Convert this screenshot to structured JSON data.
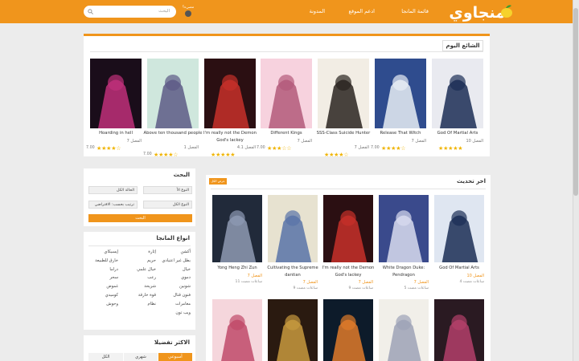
{
  "header": {
    "logo_text": "منجاوي",
    "nav": [
      "قائمة المانجا",
      "ادعم الموقع",
      "المدونة"
    ],
    "search_placeholder": "البحث",
    "mode_label": "مضيء؟",
    "brand_color": "#f0951c"
  },
  "trending": {
    "title": "الشائع اليوم",
    "items": [
      {
        "title": "God Of Martial Arts",
        "chapter": "الفصل 10",
        "rating": "",
        "stars": 5,
        "cover": [
          "#e9eaf0",
          "#1b2d55"
        ]
      },
      {
        "title": "Release That Witch",
        "chapter": "الفصل 7",
        "rating": "7.00",
        "stars": 4,
        "cover": [
          "#2f4c8e",
          "#e8eef5"
        ]
      },
      {
        "title": "SSS-Class Suicide Hunter",
        "chapter": "الفصل 7",
        "rating": "",
        "stars": 4,
        "cover": [
          "#f2ede4",
          "#2a2320"
        ]
      },
      {
        "title": "Different Kings",
        "chapter": "الفصل 7",
        "rating": "7.00",
        "stars": 3,
        "cover": [
          "#f7d2de",
          "#b35a7a"
        ]
      },
      {
        "title": "I'm really not the Demon God's lackey",
        "chapter": "الفصل 4.1",
        "rating": "",
        "stars": 5,
        "cover": [
          "#2b0f12",
          "#c7302a"
        ]
      },
      {
        "title": "Above ten thousand people",
        "chapter": "الفصل 1",
        "rating": "7.00",
        "stars": 4,
        "cover": [
          "#cfe7dd",
          "#5d5a86"
        ]
      },
      {
        "title": "Hoarding in hell",
        "chapter": "الفصل 7",
        "rating": "7.00",
        "stars": 4,
        "cover": [
          "#1a0d1a",
          "#c0307a"
        ]
      }
    ]
  },
  "search_panel": {
    "title": "البحث",
    "selects": [
      "النوع الأ",
      "الحالة الكل",
      "النوع الكل",
      "ترتيب بحسب: الافتراضي"
    ],
    "button": "البحث"
  },
  "genres": {
    "title": "انواع المانجا",
    "col_right": [
      "أكشن",
      "بطل غير اعتيادي",
      "خيال",
      "دموي",
      "شونين",
      "فنون قتال",
      "مغامرات",
      "ويب تون"
    ],
    "col_mid": [
      "إثارة",
      "حريم",
      "خيال علمي",
      "رعب",
      "شريحة",
      "قوة خارقة",
      "نظام"
    ],
    "col_left": [
      "إيسيكاي",
      "خارق للطبيعة",
      "دراما",
      "سحر",
      "غموض",
      "كوميدي",
      "وحوش"
    ]
  },
  "most_viewed": {
    "title": "الاكثر تفضيلا",
    "tabs": [
      "أسبوعي",
      "شهري",
      "الكل"
    ]
  },
  "latest": {
    "title": "اخر تحديث",
    "badge": "عرض الكل",
    "items": [
      {
        "title": "God Of Martial Arts",
        "chapter": "الفصل 10",
        "time": "4 ساعات مضت",
        "cover": [
          "#dfe6f1",
          "#1b2d55"
        ]
      },
      {
        "title": "White Dragon Duke: Pendragon",
        "chapter": "الفصل 7",
        "time": "5 ساعات مضت",
        "cover": [
          "#3a4a8c",
          "#d9dcef"
        ]
      },
      {
        "title": "I'm really not the Demon God's lackey",
        "chapter": "الفصل 7",
        "time": "9 ساعات مضت",
        "cover": [
          "#2b0f12",
          "#c7302a"
        ]
      },
      {
        "title": "Cultivating the Supreme dantian",
        "chapter": "الفصل 7",
        "time": "9 ساعات مضت",
        "cover": [
          "#e7e2d0",
          "#5873a8"
        ]
      },
      {
        "title": "Yong Heng Zhi Zun",
        "chapter": "الفصل 7",
        "time": "11 ساعات مضت",
        "cover": [
          "#212a3a",
          "#8e9ab3"
        ]
      }
    ],
    "row2_covers": [
      [
        "#2a1a22",
        "#b3406a"
      ],
      [
        "#f1efe9",
        "#9da2b6"
      ],
      [
        "#0d1b2a",
        "#e07a2a"
      ],
      [
        "#2a1a10",
        "#c89a3e"
      ],
      [
        "#f5d6dc",
        "#c04a6a"
      ]
    ]
  }
}
